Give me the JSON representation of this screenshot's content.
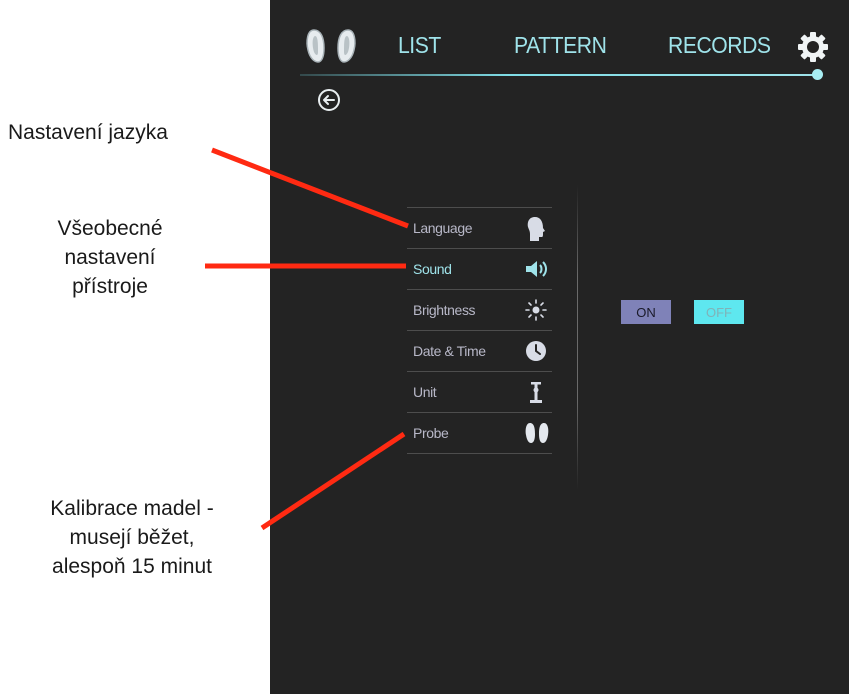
{
  "nav": {
    "tabs": [
      {
        "label": "LIST"
      },
      {
        "label": "PATTERN"
      },
      {
        "label": "RECORDS"
      }
    ],
    "logo_icon": "pair-of-probes-icon",
    "settings_icon": "gear-icon",
    "back_icon": "back-arrow-icon"
  },
  "settings_menu": {
    "items": [
      {
        "label": "Language",
        "icon": "head-silhouette-icon"
      },
      {
        "label": "Sound",
        "icon": "speaker-icon",
        "active": true
      },
      {
        "label": "Brightness",
        "icon": "sun-icon"
      },
      {
        "label": "Date & Time",
        "icon": "clock-icon"
      },
      {
        "label": "Unit",
        "icon": "measure-icon"
      },
      {
        "label": "Probe",
        "icon": "pair-of-probes-icon"
      }
    ]
  },
  "toggle": {
    "on_label": "ON",
    "off_label": "OFF",
    "selected": "OFF"
  },
  "annotations": {
    "language": "Nastavení jazyka",
    "general_line1": "Všeobecné",
    "general_line2": "nastavení",
    "general_line3": "přístroje",
    "probe_line1": "Kalibrace madel -",
    "probe_line2": "musejí běžet,",
    "probe_line3": "alespoň 15 minut"
  },
  "colors": {
    "screen_bg": "#232323",
    "accent": "#9fe3ea",
    "arrow": "#ff2a12",
    "on_button": "#7f82b8",
    "off_button": "#5ee7ef"
  }
}
